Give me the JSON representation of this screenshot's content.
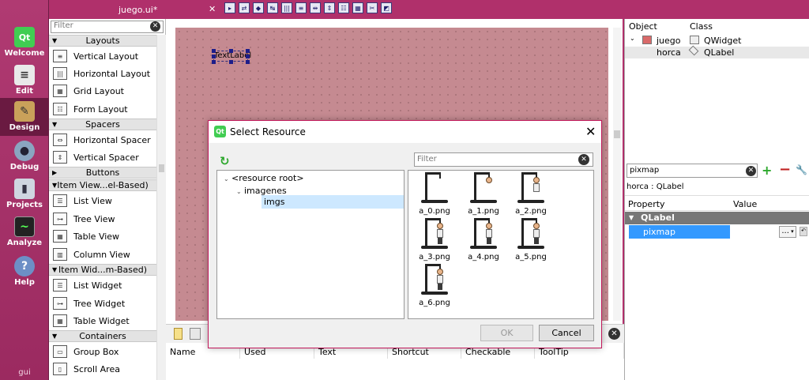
{
  "modes": [
    {
      "label": "Welcome",
      "icon": "qt-logo-icon",
      "glyph": "Qt"
    },
    {
      "label": "Edit",
      "icon": "edit-icon",
      "glyph": "≡"
    },
    {
      "label": "Design",
      "icon": "design-icon",
      "glyph": "✎"
    },
    {
      "label": "Debug",
      "icon": "debug-icon",
      "glyph": "●"
    },
    {
      "label": "Projects",
      "icon": "projects-icon",
      "glyph": "▮"
    },
    {
      "label": "Analyze",
      "icon": "analyze-icon",
      "glyph": "~"
    },
    {
      "label": "Help",
      "icon": "help-icon",
      "glyph": "?"
    }
  ],
  "mode_footer": "gui",
  "document": {
    "title": "juego.ui*",
    "close": "✕"
  },
  "widget_box": {
    "filter_placeholder": "Filter",
    "categories": {
      "layouts": "Layouts",
      "spacers": "Spacers",
      "buttons": "Buttons",
      "item_views": "Item View...el-Based)",
      "item_widgets": "Item Wid...m-Based)",
      "containers": "Containers"
    },
    "items": {
      "vertical_layout": "Vertical Layout",
      "horizontal_layout": "Horizontal Layout",
      "grid_layout": "Grid Layout",
      "form_layout": "Form Layout",
      "horizontal_spacer": "Horizontal Spacer",
      "vertical_spacer": "Vertical Spacer",
      "list_view": "List View",
      "tree_view": "Tree View",
      "table_view": "Table View",
      "column_view": "Column View",
      "list_widget": "List Widget",
      "tree_widget": "Tree Widget",
      "table_widget": "Table Widget",
      "group_box": "Group Box",
      "scroll_area": "Scroll Area"
    }
  },
  "form": {
    "label_text": "TextLabel"
  },
  "action_editor": {
    "columns": [
      "Name",
      "Used",
      "Text",
      "Shortcut",
      "Checkable",
      "ToolTip"
    ]
  },
  "object_inspector": {
    "col_object": "Object",
    "col_class": "Class",
    "rows": [
      {
        "object": "juego",
        "class": "QWidget"
      },
      {
        "object": "horca",
        "class": "QLabel"
      }
    ]
  },
  "property_editor": {
    "filter_value": "pixmap",
    "object_line": "horca : QLabel",
    "col_property": "Property",
    "col_value": "Value",
    "class_group": "QLabel",
    "property_name": "pixmap",
    "dots": "..."
  },
  "dialog": {
    "title": "Select Resource",
    "filter_placeholder": "Filter",
    "tree": {
      "root": "<resource root>",
      "prefix": "imagenes",
      "folder": "imgs"
    },
    "resources": [
      {
        "name": "a_0.png",
        "stage": 0
      },
      {
        "name": "a_1.png",
        "stage": 1
      },
      {
        "name": "a_2.png",
        "stage": 2
      },
      {
        "name": "a_3.png",
        "stage": 3
      },
      {
        "name": "a_4.png",
        "stage": 4
      },
      {
        "name": "a_5.png",
        "stage": 5
      },
      {
        "name": "a_6.png",
        "stage": 6
      }
    ],
    "ok": "OK",
    "cancel": "Cancel"
  }
}
